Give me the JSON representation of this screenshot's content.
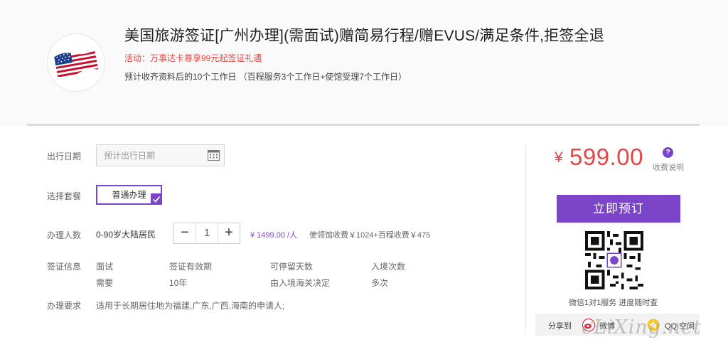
{
  "product": {
    "title": "美国旅游签证[广州办理](需面试)赠简易行程/赠EVUS/满足条件,拒签全退",
    "promo": "活动：万事达卡尊享99元起签证礼遇",
    "timing": "预计收齐资料后的10个工作日 （百程服务3个工作日+使馆受理7个工作日）",
    "flag_icon": "us-flag-icon"
  },
  "form": {
    "date_label": "出行日期",
    "date_placeholder": "预计出行日期",
    "package_label": "选择套餐",
    "package_option": "普通办理",
    "applicant_label": "办理人数",
    "applicant_type": "0-90岁大陆居民",
    "quantity": "1",
    "minus": "−",
    "plus": "+",
    "unit_price": "¥ 1499.00 /人",
    "fee_breakdown": "使领馆收费￥1024+百程收费￥475"
  },
  "visa_info": {
    "label": "签证信息",
    "headers": [
      "面试",
      "签证有效期",
      "可停留天数",
      "入境次数"
    ],
    "values": [
      "需要",
      "10年",
      "由入境海关决定",
      "多次"
    ]
  },
  "requirements": {
    "label": "办理要求",
    "text": "适用于长期居住地为福建,广东,广西,海南的申请人;"
  },
  "pricing": {
    "currency": "¥",
    "price": "599.00",
    "fee_note": "收费说明",
    "help": "?",
    "book_button": "立即预订",
    "qr_caption": "微信1对1服务 进度随时查"
  },
  "share": {
    "label": "分享到",
    "weibo": "微博",
    "qq": "QQ 空间"
  },
  "watermark": "eLiXing.net",
  "colors": {
    "accent": "#7b44c9",
    "price": "#e64545"
  }
}
